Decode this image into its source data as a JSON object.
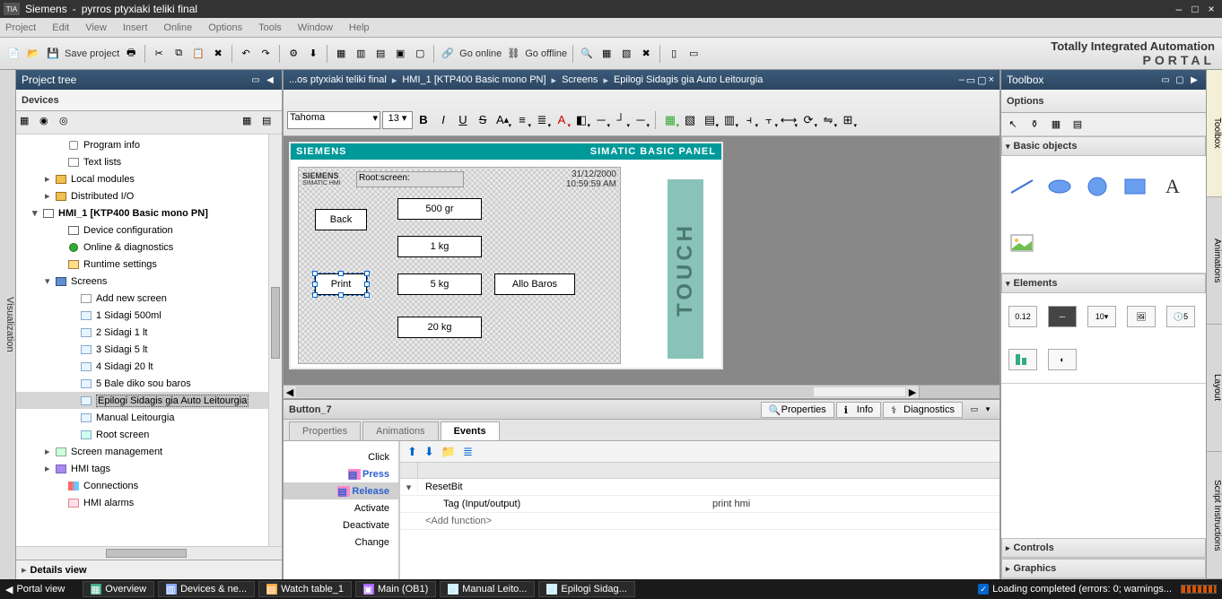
{
  "titlebar": {
    "app": "Siemens",
    "project": "pyrros ptyxiaki teliki final"
  },
  "menu": {
    "project": "Project",
    "edit": "Edit",
    "view": "View",
    "insert": "Insert",
    "online": "Online",
    "options": "Options",
    "tools": "Tools",
    "window": "Window",
    "help": "Help"
  },
  "toolbar": {
    "save": "Save project",
    "goonline": "Go online",
    "gooffline": "Go offline"
  },
  "brand": {
    "line1": "Totally Integrated Automation",
    "line2": "PORTAL"
  },
  "side": {
    "visualization": "Visualization"
  },
  "projtree": {
    "title": "Project tree",
    "devices": "Devices",
    "details": "Details view"
  },
  "tree": {
    "proginfo": "Program info",
    "textlists": "Text lists",
    "localmod": "Local modules",
    "distio": "Distributed I/O",
    "hmi": "HMI_1 [KTP400 Basic mono PN]",
    "devcfg": "Device configuration",
    "onlinediag": "Online & diagnostics",
    "rtset": "Runtime settings",
    "screens": "Screens",
    "addscr": "Add new screen",
    "s1": "1 Sidagi 500ml",
    "s2": "2 Sidagi 1 lt",
    "s3": "3 Sidagi 5 lt",
    "s4": "4 Sidagi 20 lt",
    "s5": "5 Bale diko sou baros",
    "s6": "Epilogi Sidagis gia Auto Leitourgia",
    "s7": "Manual Leitourgia",
    "s8": "Root screen",
    "scrmgmt": "Screen management",
    "hmitags": "HMI tags",
    "conn": "Connections",
    "alarms": "HMI alarms"
  },
  "breadcrumb": {
    "p1": "...os ptyxiaki teliki final",
    "p2": "HMI_1 [KTP400 Basic mono PN]",
    "p3": "Screens",
    "p4": "Epilogi Sidagis gia Auto Leitourgia"
  },
  "fmt": {
    "font": "Tahoma",
    "size": "13"
  },
  "hmi": {
    "vendor": "SIEMENS",
    "panel": "SIMATIC BASIC PANEL",
    "subvendor": "SIEMENS",
    "subline": "SIMATIC HMI",
    "rootlabel": "Root:screen:",
    "date": "31/12/2000",
    "time": "10:59:59 AM",
    "btn_back": "Back",
    "btn_print": "Print",
    "btn_500": "500 gr",
    "btn_1kg": "1 kg",
    "btn_5kg": "5 kg",
    "btn_20kg": "20 kg",
    "btn_allo": "Allo Baros",
    "touch": "TOUCH"
  },
  "props": {
    "object": "Button_7",
    "tab_props": "Properties",
    "tab_info": "Info",
    "tab_diag": "Diagnostics",
    "sub_props": "Properties",
    "sub_anim": "Animations",
    "sub_events": "Events",
    "ev_click": "Click",
    "ev_press": "Press",
    "ev_release": "Release",
    "ev_activate": "Activate",
    "ev_deactivate": "Deactivate",
    "ev_change": "Change",
    "fn_resetbit": "ResetBit",
    "fn_tag_label": "Tag (Input/output)",
    "fn_tag_value": "print hmi",
    "fn_add": "<Add function>"
  },
  "toolbox": {
    "title": "Toolbox",
    "options": "Options",
    "cat_basic": "Basic objects",
    "cat_elements": "Elements",
    "cat_controls": "Controls",
    "cat_graphics": "Graphics"
  },
  "rtabs": {
    "toolbox": "Toolbox",
    "anim": "Animations",
    "layout": "Layout",
    "script": "Script Instructions"
  },
  "status": {
    "portal": "Portal view",
    "overview": "Overview",
    "devnet": "Devices & ne...",
    "watch": "Watch table_1",
    "main": "Main (OB1)",
    "manual": "Manual Leito...",
    "epilogi": "Epilogi Sidag...",
    "msg": "Loading completed (errors: 0; warnings..."
  }
}
